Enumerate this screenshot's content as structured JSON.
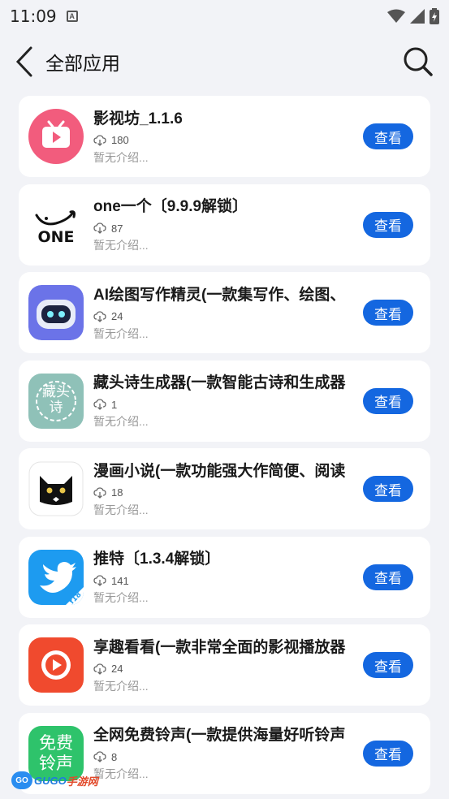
{
  "status_bar": {
    "time": "11:09",
    "notif_letter": "A"
  },
  "header": {
    "title": "全部应用"
  },
  "apps": [
    {
      "name": "影视坊_1.1.6",
      "downloads": "180",
      "desc": "暂无介绍...",
      "button": "查看",
      "icon": "tv-play-icon",
      "color": "#f25c7d"
    },
    {
      "name": "one一个〔9.9.9解锁〕",
      "downloads": "87",
      "desc": "暂无介绍...",
      "button": "查看",
      "icon": "one-logo-icon",
      "color": "#ffffff",
      "icon_text": "ONE"
    },
    {
      "name": "AI绘图写作精灵(一款集写作、绘图、",
      "downloads": "24",
      "desc": "暂无介绍...",
      "button": "查看",
      "icon": "robot-icon",
      "color": "#6b73e8"
    },
    {
      "name": "藏头诗生成器(一款智能古诗和生成器",
      "downloads": "1",
      "desc": "暂无介绍...",
      "button": "查看",
      "icon": "poem-seal-icon",
      "color": "#8fc1b8",
      "icon_text": "藏头诗"
    },
    {
      "name": "漫画小说(一款功能强大作简便、阅读",
      "downloads": "18",
      "desc": "暂无介绍...",
      "button": "查看",
      "icon": "black-cat-icon",
      "color": "#ffffff"
    },
    {
      "name": "推特〔1.3.4解锁〕",
      "downloads": "141",
      "desc": "暂无介绍...",
      "button": "查看",
      "icon": "twitter-bird-icon",
      "color": "#1d9bf0",
      "icon_text": "f18"
    },
    {
      "name": "享趣看看(一款非常全面的影视播放器",
      "downloads": "24",
      "desc": "暂无介绍...",
      "button": "查看",
      "icon": "video-play-icon",
      "color": "#f04a2e"
    },
    {
      "name": "全网免费铃声(一款提供海量好听铃声",
      "downloads": "8",
      "desc": "暂无介绍...",
      "button": "查看",
      "icon": "ringtone-icon",
      "color": "#2ec36b",
      "icon_text": "免费铃声"
    }
  ],
  "watermark": {
    "badge": "GO",
    "text1": "GUGO",
    "text2": "手游网"
  }
}
